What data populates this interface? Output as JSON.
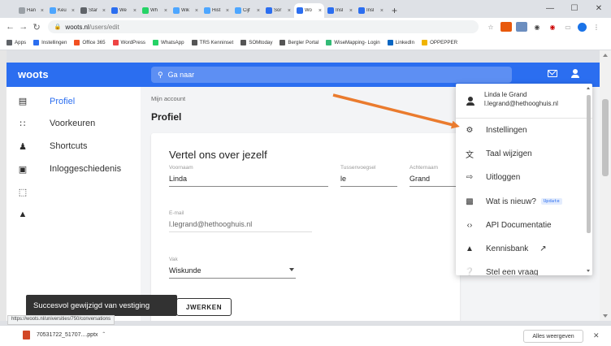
{
  "browser": {
    "tabs": [
      {
        "label": "Han",
        "color": "#9aa0a6"
      },
      {
        "label": "Keu",
        "color": "#4da6ff"
      },
      {
        "label": "Star",
        "color": "#5f6368"
      },
      {
        "label": "We",
        "color": "#2b6ef0"
      },
      {
        "label": "Wh",
        "color": "#25d366"
      },
      {
        "label": "Wik",
        "color": "#4da6ff"
      },
      {
        "label": "Hist",
        "color": "#4da6ff"
      },
      {
        "label": "Cijf",
        "color": "#4da6ff"
      },
      {
        "label": "Sor",
        "color": "#2b6ef0"
      },
      {
        "label": "Wo",
        "color": "#2b6ef0"
      },
      {
        "label": "Insl",
        "color": "#2b6ef0"
      },
      {
        "label": "Insl",
        "color": "#2b6ef0"
      }
    ],
    "new_tab": "+",
    "url_host": "woots.nl",
    "url_path": "/users/edit",
    "bookmarks": [
      "Apps",
      "Instellingen",
      "Office 365",
      "WordPress",
      "WhatsApp",
      "TRS Kenninset",
      "SOMtoday",
      "Bergler Portal",
      "WiseMapping- Login",
      "LinkedIn",
      "OPPEPPER"
    ],
    "bookmark_colors": [
      "#5f6368",
      "#2b6ef0",
      "#f25022",
      "#e44",
      "#25d366",
      "#555",
      "#555",
      "#555",
      "#3b7",
      "#0a66c2",
      "#f0b400"
    ]
  },
  "app": {
    "logo": "woots",
    "search_placeholder": "Ga naar",
    "accent": "#2b6ef0"
  },
  "subnav": {
    "items": [
      {
        "label": "Profiel",
        "active": true
      },
      {
        "label": "Voorkeuren",
        "active": false
      },
      {
        "label": "Shortcuts",
        "active": false
      },
      {
        "label": "Inloggeschiedenis",
        "active": false
      }
    ]
  },
  "content": {
    "breadcrumb": "Mijn account",
    "page_title": "Profiel",
    "card_title": "Vertel ons over jezelf",
    "fields": {
      "voornaam": {
        "label": "Voornaam",
        "value": "Linda"
      },
      "tussenvoegsel": {
        "label": "Tussenvoegsel",
        "value": "le"
      },
      "achternaam": {
        "label": "Achternaam",
        "value": "Grand"
      },
      "email": {
        "label": "E-mail",
        "value": "l.legrand@hethooghuis.nl"
      },
      "vak": {
        "label": "Vak",
        "value": "Wiskunde"
      }
    },
    "update_button": "BIJWERKEN",
    "update_button_visible": "JWERKEN"
  },
  "dropdown": {
    "user_name": "Linda le Grand",
    "user_email": "l.legrand@hethooghuis.nl",
    "items": [
      {
        "label": "Instellingen",
        "icon": "gear-icon"
      },
      {
        "label": "Taal wijzigen",
        "icon": "translate-icon"
      },
      {
        "label": "Uitloggen",
        "icon": "logout-icon"
      },
      {
        "label": "Wat is nieuw?",
        "icon": "news-icon",
        "badge": "Update"
      },
      {
        "label": "API Documentatie",
        "icon": "code-icon"
      },
      {
        "label": "Kennisbank",
        "icon": "shapes-icon"
      },
      {
        "label": "Stel een vraag",
        "icon": "help-icon"
      }
    ]
  },
  "toast": "Succesvol gewijzigd van vestiging",
  "status_url": "https://woots.nl/universities/750/conversations",
  "downloads": {
    "file": "70531722_51707....pptx",
    "show_all": "Alles weergeven"
  }
}
